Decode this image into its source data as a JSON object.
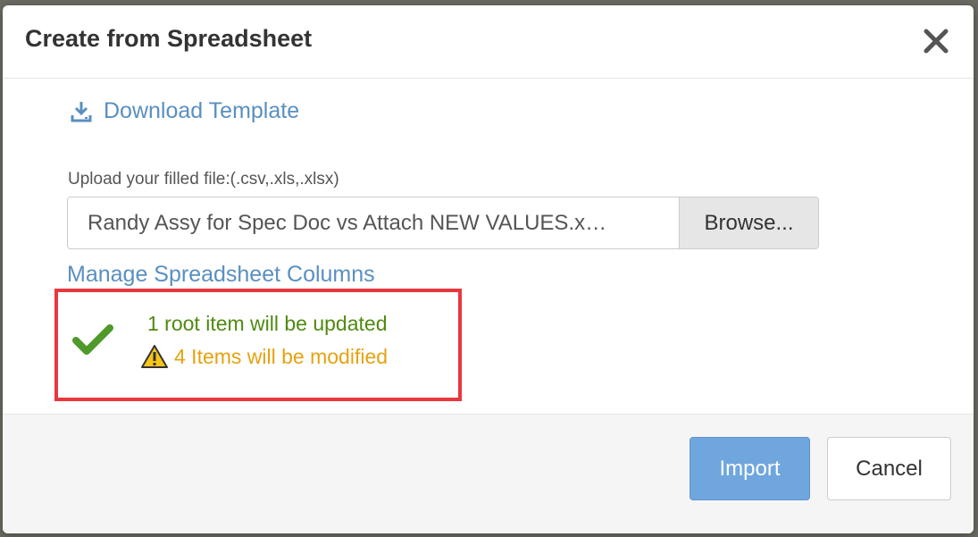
{
  "dialog": {
    "title": "Create from Spreadsheet",
    "close_icon": "close-icon"
  },
  "download": {
    "icon": "download-icon",
    "label": "Download Template"
  },
  "upload": {
    "label": "Upload your filled file:(.csv,.xls,.xlsx)",
    "file_name": "Randy Assy for Spec Doc vs Attach NEW VALUES.x…",
    "browse_label": "Browse..."
  },
  "manage_columns": {
    "label": "Manage Spreadsheet Columns"
  },
  "status": {
    "success_icon": "checkmark-icon",
    "success_text": "1 root item will be updated",
    "success_color": "#4f8a10",
    "warning_icon": "warning-icon",
    "warning_text": "4 Items will be modified",
    "warning_color": "#e6a20f",
    "highlight_color": "#e8373e"
  },
  "footer": {
    "import_label": "Import",
    "cancel_label": "Cancel",
    "import_color": "#6fa6de"
  }
}
